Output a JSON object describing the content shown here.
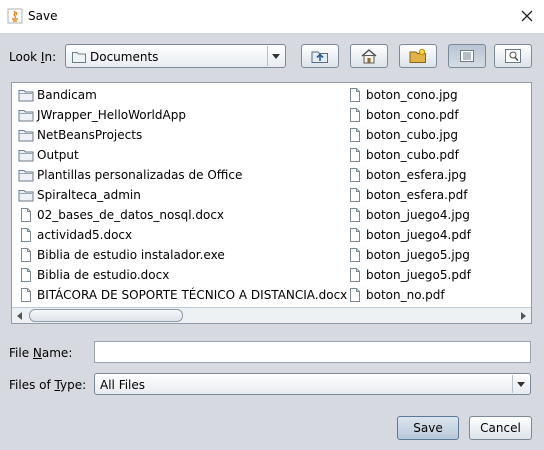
{
  "window": {
    "title": "Save"
  },
  "look_in": {
    "label_before": "Look ",
    "label_mnemonic": "I",
    "label_after": "n:",
    "value": "Documents"
  },
  "toolbar": [
    {
      "name": "up-one-level-button",
      "icon": "folder-up-icon"
    },
    {
      "name": "home-button",
      "icon": "home-icon"
    },
    {
      "name": "new-folder-button",
      "icon": "new-folder-icon"
    },
    {
      "name": "list-view-button",
      "icon": "list-view-icon",
      "pressed": true
    },
    {
      "name": "details-view-button",
      "icon": "details-view-icon"
    }
  ],
  "files": {
    "column1": [
      {
        "name": "Bandicam",
        "type": "folder"
      },
      {
        "name": "JWrapper_HelloWorldApp",
        "type": "folder"
      },
      {
        "name": "NetBeansProjects",
        "type": "folder"
      },
      {
        "name": "Output",
        "type": "folder"
      },
      {
        "name": "Plantillas personalizadas de Office",
        "type": "folder"
      },
      {
        "name": "Spiralteca_admin",
        "type": "folder"
      },
      {
        "name": "02_bases_de_datos_nosql.docx",
        "type": "file"
      },
      {
        "name": "actividad5.docx",
        "type": "file"
      },
      {
        "name": "Biblia de estudio instalador.exe",
        "type": "file"
      },
      {
        "name": "Biblia de estudio.docx",
        "type": "file"
      },
      {
        "name": "BITÁCORA DE SOPORTE TÉCNICO A DISTANCIA.docx",
        "type": "file"
      }
    ],
    "column2": [
      {
        "name": "boton_cono.jpg",
        "type": "file"
      },
      {
        "name": "boton_cono.pdf",
        "type": "file"
      },
      {
        "name": "boton_cubo.jpg",
        "type": "file"
      },
      {
        "name": "boton_cubo.pdf",
        "type": "file"
      },
      {
        "name": "boton_esfera.jpg",
        "type": "file"
      },
      {
        "name": "boton_esfera.pdf",
        "type": "file"
      },
      {
        "name": "boton_juego4.jpg",
        "type": "file"
      },
      {
        "name": "boton_juego4.pdf",
        "type": "file"
      },
      {
        "name": "boton_juego5.jpg",
        "type": "file"
      },
      {
        "name": "boton_juego5.pdf",
        "type": "file"
      },
      {
        "name": "boton_no.pdf",
        "type": "file"
      }
    ]
  },
  "file_name": {
    "label_before": "File ",
    "label_mnemonic": "N",
    "label_after": "ame:",
    "value": ""
  },
  "file_type": {
    "label_before": "Files of ",
    "label_mnemonic": "T",
    "label_after": "ype:",
    "value": "All Files"
  },
  "buttons": {
    "save": "Save",
    "cancel": "Cancel"
  }
}
